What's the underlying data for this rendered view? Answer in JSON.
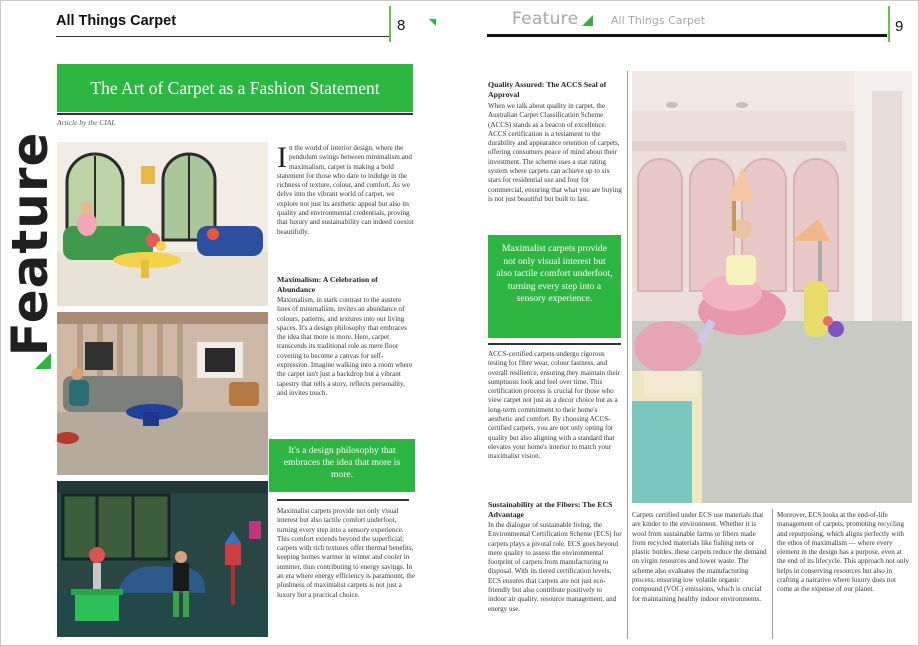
{
  "left_page": {
    "header_title": "All Things Carpet",
    "page_number": "8",
    "vertical_label": "Feature",
    "banner_title": "The Art of Carpet as a Fashion Statement",
    "byline": "Article by the CIAL",
    "intro_dropcap": "I",
    "intro_text": "n the world of interior design, where the pendulum swings between minimalism and maximalism, carpet is making a bold statement for those who dare to indulge in the richness of texture, colour, and comfort. As we delve into the vibrant world of carpet, we explore not just its aesthetic appeal but also its quality and environmental credentials, proving that luxury and sustainability can indeed coexist beautifully.",
    "section1_heading": "Maximalism: A Celebration of Abundance",
    "section1_text": "Maximalism, in stark contrast to the austere lines of minimalism, invites an abundance of colours, patterns, and textures into our living spaces. It's a design philosophy that embraces the idea that more is more. Here, carpet transcends its traditional role as mere floor covering to become a canvas for self-expression. Imagine walking into a room where the carpet isn't just a backdrop but a vibrant tapestry that tells a story, reflects personality, and invites touch.",
    "pull_quote": "It's a design philosophy that embraces the idea that more is more.",
    "section1_cont": "Maximalist carpets provide not only visual interest but also tactile comfort underfoot, turning every step into a sensory experience. This comfort extends beyond the superficial; carpets with rich textures offer thermal benefits, keeping homes warmer in winter and cooler in summer, thus contributing to energy savings. In an era where energy efficiency is paramount, the plushness of maximalist carpets is not just a luxury but a practical choice."
  },
  "right_page": {
    "header_feature": "Feature",
    "header_subtitle": "All Things Carpet",
    "page_number": "9",
    "section2_heading": "Quality Assured: The ACCS Seal of Approval",
    "section2_text": "When we talk about quality in carpet, the Australian Carpet Classification Scheme (ACCS) stands as a beacon of excellence. ACCS certification is a testament to the durability and appearance retention of carpets, offering consumers peace of mind about their investment. The scheme uses a star rating system where carpets can achieve up to six stars for residential use and four for commercial, ensuring that what you are buying is not just beautiful but built to last.",
    "pull_quote": "Maximalist carpets provide not only visual interest but also tactile comfort underfoot, turning every step into a sensory experience.",
    "section2_cont": "ACCS-certified carpets undergo rigorous testing for fibre wear, colour fastness, and overall resilience, ensuring they maintain their sumptuous look and feel over time. This certification process is crucial for those who view carpet not just as a decor choice but as a long-term commitment to their home's aesthetic and comfort. By choosing ACCS-certified carpets, you are not only opting for quality but also aligning with a standard that elevates your home's interior to match your maximalist vision.",
    "section3_heading": "Sustainability at the Fibers: The ECS Advantage",
    "section3_text": "In the dialogue of sustainable living, the Environmental Certification Scheme (ECS) for carpets plays a pivotal role. ECS goes beyond mere quality to assess the environmental footprint of carpets from manufacturing to disposal. With its tiered certification levels, ECS ensures that carpets are not just eco-friendly but also contribute positively to indoor air quality, resource management, and energy use.",
    "col2_text": "Carpets certified under ECS use materials that are kinder to the environment. Whether it is wool from sustainable farms or fibers made from recycled materials like fishing nets or plastic bottles, these carpets reduce the demand on virgin resources and lower waste. The scheme also evaluates the manufacturing process, ensuring low volatile organic compound (VOC) emissions, which is crucial for maintaining healthy indoor environments.",
    "col3_text": "Moreover, ECS looks at the end-of-life management of carpets, promoting recycling and repurposing, which aligns perfectly with the ethos of maximalism — where every element in the design has a purpose, even at the end of its lifecycle. This approach not only helps in conserving resources but also in crafting a narrative where luxury does not come at the expense of our planet."
  },
  "colors": {
    "brand_green": "#2db742",
    "header_grey": "#a7a7a7",
    "text": "#333333"
  }
}
